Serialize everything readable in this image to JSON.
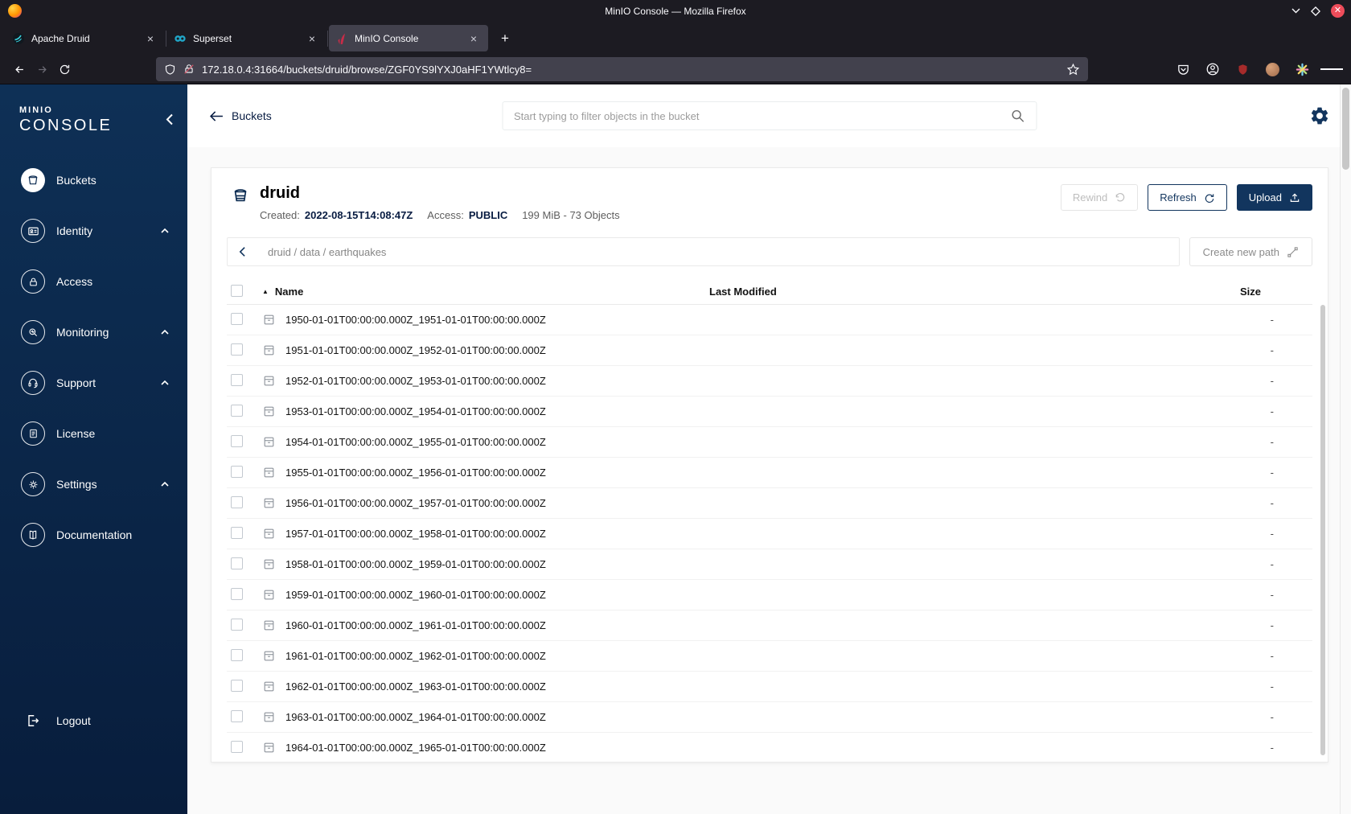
{
  "window": {
    "title": "MinIO Console — Mozilla Firefox"
  },
  "browser": {
    "tabs": [
      {
        "label": "Apache Druid"
      },
      {
        "label": "Superset"
      },
      {
        "label": "MinIO Console"
      }
    ],
    "tab_close_glyph": "×",
    "new_tab_glyph": "+",
    "url": "172.18.0.4:31664/buckets/druid/browse/ZGF0YS9lYXJ0aHF1YWtlcy8="
  },
  "sidebar": {
    "logo_line1": "MINIO",
    "logo_line2": "CONSOLE",
    "items": [
      {
        "label": "Buckets"
      },
      {
        "label": "Identity"
      },
      {
        "label": "Access"
      },
      {
        "label": "Monitoring"
      },
      {
        "label": "Support"
      },
      {
        "label": "License"
      },
      {
        "label": "Settings"
      },
      {
        "label": "Documentation"
      }
    ],
    "logout_label": "Logout"
  },
  "topbar": {
    "back_label": "Buckets",
    "search_placeholder": "Start typing to filter objects in the bucket"
  },
  "bucket": {
    "name": "druid",
    "created_label": "Created:",
    "created_value": "2022-08-15T14:08:47Z",
    "access_label": "Access:",
    "access_value": "PUBLIC",
    "usage": "199 MiB - 73 Objects",
    "rewind_label": "Rewind",
    "refresh_label": "Refresh",
    "upload_label": "Upload"
  },
  "pathbar": {
    "path": "druid / data / earthquakes",
    "create_new_path_label": "Create new path"
  },
  "table": {
    "header_name": "Name",
    "header_last_modified": "Last Modified",
    "header_size": "Size",
    "sort_glyph": "▲",
    "rows": [
      {
        "name": "1950-01-01T00:00:00.000Z_1951-01-01T00:00:00.000Z",
        "size": "-"
      },
      {
        "name": "1951-01-01T00:00:00.000Z_1952-01-01T00:00:00.000Z",
        "size": "-"
      },
      {
        "name": "1952-01-01T00:00:00.000Z_1953-01-01T00:00:00.000Z",
        "size": "-"
      },
      {
        "name": "1953-01-01T00:00:00.000Z_1954-01-01T00:00:00.000Z",
        "size": "-"
      },
      {
        "name": "1954-01-01T00:00:00.000Z_1955-01-01T00:00:00.000Z",
        "size": "-"
      },
      {
        "name": "1955-01-01T00:00:00.000Z_1956-01-01T00:00:00.000Z",
        "size": "-"
      },
      {
        "name": "1956-01-01T00:00:00.000Z_1957-01-01T00:00:00.000Z",
        "size": "-"
      },
      {
        "name": "1957-01-01T00:00:00.000Z_1958-01-01T00:00:00.000Z",
        "size": "-"
      },
      {
        "name": "1958-01-01T00:00:00.000Z_1959-01-01T00:00:00.000Z",
        "size": "-"
      },
      {
        "name": "1959-01-01T00:00:00.000Z_1960-01-01T00:00:00.000Z",
        "size": "-"
      },
      {
        "name": "1960-01-01T00:00:00.000Z_1961-01-01T00:00:00.000Z",
        "size": "-"
      },
      {
        "name": "1961-01-01T00:00:00.000Z_1962-01-01T00:00:00.000Z",
        "size": "-"
      },
      {
        "name": "1962-01-01T00:00:00.000Z_1963-01-01T00:00:00.000Z",
        "size": "-"
      },
      {
        "name": "1963-01-01T00:00:00.000Z_1964-01-01T00:00:00.000Z",
        "size": "-"
      },
      {
        "name": "1964-01-01T00:00:00.000Z_1965-01-01T00:00:00.000Z",
        "size": "-"
      }
    ]
  },
  "colors": {
    "sidebar_navy_top": "#0E3056",
    "sidebar_navy_bottom": "#081D3C",
    "accent_navy": "#12355E",
    "minio_red": "#C72C48",
    "firefox_chrome": "#1C1B22",
    "firefox_tab_active": "#42414D"
  }
}
